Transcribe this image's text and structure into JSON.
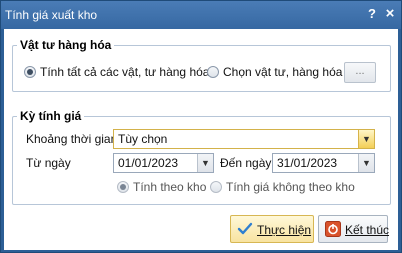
{
  "window": {
    "title": "Tính giá xuất kho",
    "help_glyph": "?",
    "close_glyph": "×"
  },
  "materials": {
    "legend": "Vật tư hàng hóa",
    "option_all": "Tính tất cả các vật, tư hàng hóa",
    "option_select": "Chọn vật tư, hàng hóa",
    "selected": "all",
    "browse_label": "..."
  },
  "period": {
    "legend": "Kỳ tính giá",
    "time_label": "Khoảng thời gian",
    "time_value": "Tùy chọn",
    "from_label": "Từ ngày",
    "from_value": "01/01/2023",
    "to_label": "Đến ngày",
    "to_value": "31/01/2023",
    "option_by_warehouse": "Tính theo kho",
    "option_no_warehouse": "Tính giá không theo kho",
    "selected_mode": "by_warehouse"
  },
  "actions": {
    "run_label": "Thực hiện",
    "close_label": "Kết thúc"
  },
  "colors": {
    "titlebar": "#3668a2",
    "border": "#2d5f96",
    "primary_button": "#f8e3a0",
    "close_icon": "#d9532c",
    "check_icon": "#2f7fd0"
  },
  "icons": {
    "run": "check-icon",
    "close": "exit-icon",
    "combo": "dropdown-arrow-icon"
  }
}
